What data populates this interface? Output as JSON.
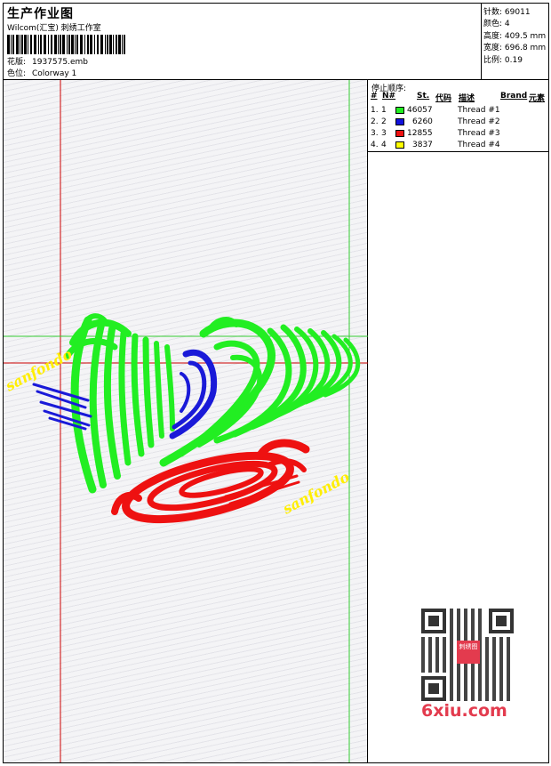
{
  "header": {
    "title": "生产作业图",
    "subtitle": "Wilcom(汇宝) 刺绣工作室",
    "design_label": "花版:",
    "design_value": "1937575.emb",
    "colorway_label": "色位:",
    "colorway_value": "Colorway 1"
  },
  "stats": [
    {
      "label": "针数:",
      "value": "69011"
    },
    {
      "label": "颜色:",
      "value": "4"
    },
    {
      "label": "高度:",
      "value": "409.5 mm"
    },
    {
      "label": "宽度:",
      "value": "696.8 mm"
    },
    {
      "label": "比例:",
      "value": "0.19"
    }
  ],
  "stop_sequence": {
    "title": "停止顺序:",
    "headers": {
      "num": "#",
      "n": "N#",
      "st": "St.",
      "code": "代码",
      "desc": "描述",
      "brand": "Brand",
      "elem": "元素"
    },
    "rows": [
      {
        "idx": "1.",
        "n": "1",
        "color": "#22ee22",
        "st": "46057",
        "desc": "Thread #1"
      },
      {
        "idx": "2.",
        "n": "2",
        "color": "#1111dd",
        "st": "6260",
        "desc": "Thread #2"
      },
      {
        "idx": "3.",
        "n": "3",
        "color": "#ee1111",
        "st": "12855",
        "desc": "Thread #3"
      },
      {
        "idx": "4.",
        "n": "4",
        "color": "#ffff00",
        "st": "3837",
        "desc": "Thread #4"
      }
    ]
  },
  "canvas": {
    "signature_text": "sanfondo",
    "colors": {
      "green": "#22ee22",
      "blue": "#1a1ad8",
      "red": "#ee1111",
      "yellow": "#ffee00",
      "guide_red": "#cc0000",
      "guide_green": "#33cc33"
    }
  },
  "watermark": {
    "text": "6xiu.com",
    "badge_text": "刺绣图"
  }
}
